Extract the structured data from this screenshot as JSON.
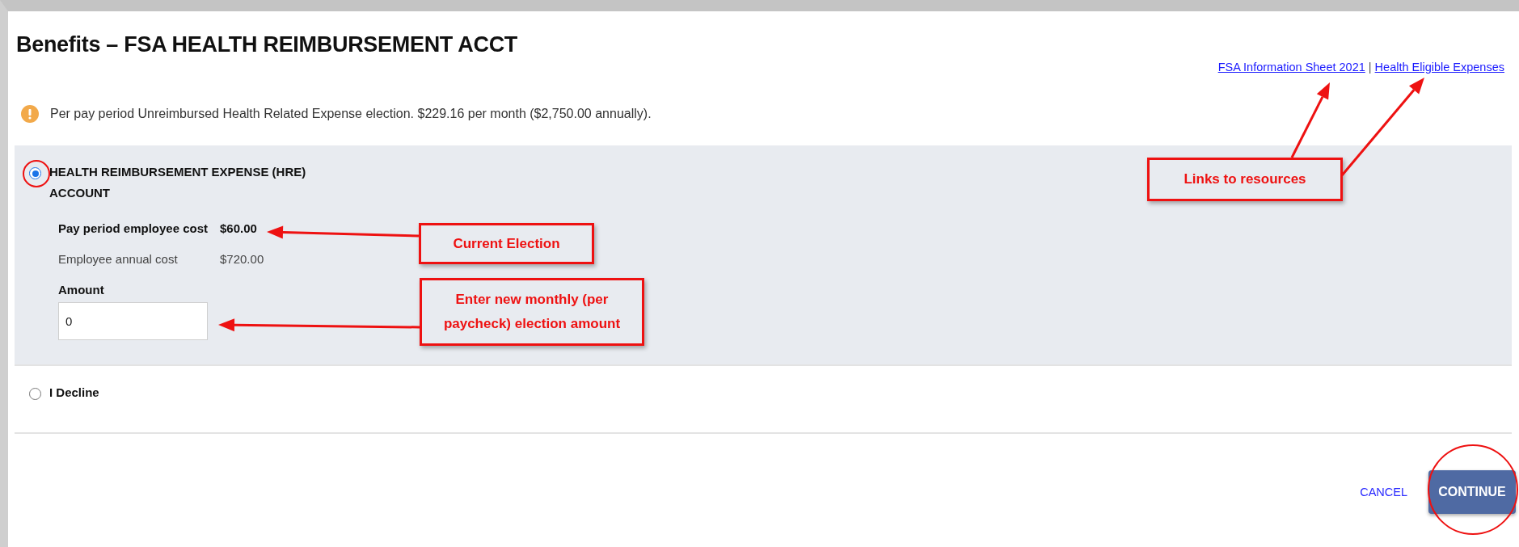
{
  "page": {
    "title": "Benefits – FSA HEALTH REIMBURSEMENT ACCT",
    "links": [
      "FSA Information Sheet 2021",
      "Health Eligible Expenses"
    ],
    "link_separator": "|"
  },
  "notice": {
    "text": "Per pay period Unreimbursed Health Related Expense election. $229.16 per month ($2,750.00 annually)."
  },
  "options": [
    {
      "kind": "detailed",
      "label": "HEALTH REIMBURSEMENT EXPENSE (HRE) ACCOUNT",
      "selected": true,
      "details": [
        {
          "label": "Pay period employee cost",
          "value": "$60.00",
          "emphasis": true
        },
        {
          "label": "Employee annual cost",
          "value": "$720.00",
          "emphasis": false
        }
      ],
      "amount": {
        "label": "Amount",
        "value": "0"
      }
    },
    {
      "kind": "simple",
      "label": "I Decline",
      "selected": false
    }
  ],
  "actions": {
    "cancel": "CANCEL",
    "continue": "CONTINUE"
  },
  "annotations": [
    {
      "text": "Current Election"
    },
    {
      "text": "Enter new monthly (per paycheck) election amount"
    },
    {
      "text": "Links to resources"
    }
  ]
}
